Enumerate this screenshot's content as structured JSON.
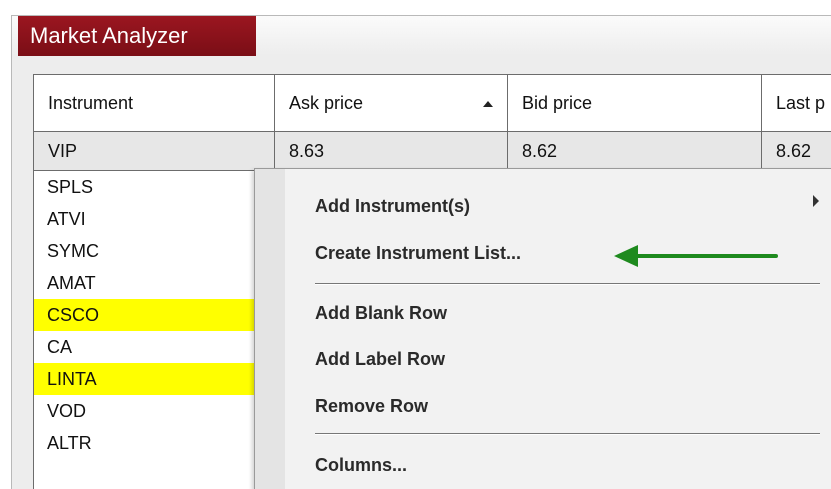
{
  "window": {
    "title": "Market Analyzer"
  },
  "grid": {
    "columns": [
      "Instrument",
      "Ask price",
      "Bid price",
      "Last p"
    ],
    "selected_row": [
      "VIP",
      "8.63",
      "8.62",
      "8.62"
    ],
    "instruments": [
      {
        "symbol": "SPLS",
        "highlight": false
      },
      {
        "symbol": "ATVI",
        "highlight": false
      },
      {
        "symbol": "SYMC",
        "highlight": false
      },
      {
        "symbol": "AMAT",
        "highlight": false
      },
      {
        "symbol": "CSCO",
        "highlight": true
      },
      {
        "symbol": "CA",
        "highlight": false
      },
      {
        "symbol": "LINTA",
        "highlight": true
      },
      {
        "symbol": "VOD",
        "highlight": false
      },
      {
        "symbol": "ALTR",
        "highlight": false
      }
    ]
  },
  "context_menu": {
    "add_instruments": "Add Instrument(s)",
    "create_list": "Create Instrument List...",
    "add_blank_row": "Add Blank Row",
    "add_label_row": "Add Label Row",
    "remove_row": "Remove Row",
    "columns": "Columns..."
  },
  "colors": {
    "title_tab": "#8b121b",
    "highlight": "#ffff00",
    "arrow": "#1e8a1e"
  },
  "icons": {
    "sort": "sort-ascending-icon",
    "submenu": "submenu-arrow-icon",
    "callout": "green-arrow-icon"
  }
}
